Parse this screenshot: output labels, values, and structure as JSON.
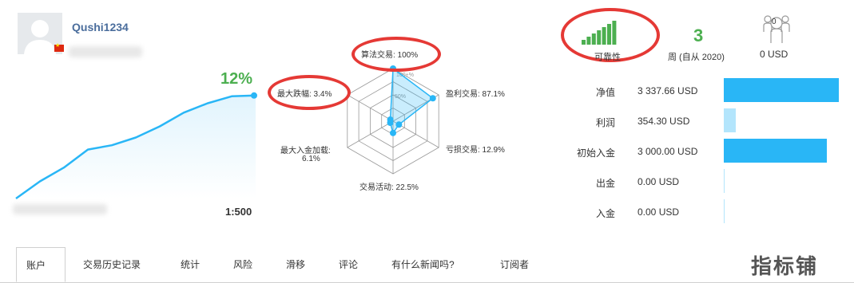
{
  "profile": {
    "username": "Qushi1234",
    "growth": "12%",
    "leverage": "1:500"
  },
  "growth_chart": {
    "type": "area",
    "values": [
      0,
      2.0,
      3.6,
      5.7,
      6.2,
      7.1,
      8.4,
      10.0,
      11.1,
      11.9,
      12.0
    ],
    "ylim": [
      0,
      13
    ],
    "color": "#29b6f6"
  },
  "radar": {
    "labels": {
      "algo": "算法交易: 100%",
      "profit": "盈利交易: 87.1%",
      "loss": "亏损交易: 12.9%",
      "activity": "交易活动: 22.5%",
      "load_line1": "最大入金加载:",
      "load_line2": "6.1%",
      "drawdown": "最大跌幅: 3.4%"
    },
    "ring_labels": [
      "100+%",
      "50%"
    ],
    "chart_data": {
      "type": "radar",
      "axes": [
        "算法交易",
        "盈利交易",
        "亏损交易",
        "交易活动",
        "最大入金加载",
        "最大跌幅"
      ],
      "values": [
        100,
        87.1,
        12.9,
        22.5,
        6.1,
        3.4
      ],
      "max": 100,
      "color": "#29b6f6"
    }
  },
  "reliability": {
    "label": "可靠性",
    "bars_total": 7,
    "bars_filled": 7,
    "color": "#4caf50"
  },
  "weeks": {
    "value": "3",
    "label": "周 (自从 2020)"
  },
  "subscribers": {
    "count": "0",
    "value": "0 USD"
  },
  "stats": [
    {
      "label": "净值",
      "value": "3 337.66 USD",
      "amount": 3337.66
    },
    {
      "label": "利润",
      "value": "354.30 USD",
      "amount": 354.3
    },
    {
      "label": "初始入金",
      "value": "3 000.00 USD",
      "amount": 3000.0
    },
    {
      "label": "出金",
      "value": "0.00 USD",
      "amount": 0
    },
    {
      "label": "入金",
      "value": "0.00 USD",
      "amount": 0
    }
  ],
  "tabs": [
    "账户",
    "交易历史记录",
    "统计",
    "风险",
    "滑移",
    "评论",
    "有什么新闻吗?",
    "订阅者"
  ],
  "active_tab": 0,
  "watermark": "指标铺",
  "colors": {
    "accent": "#29b6f6",
    "green": "#4caf50",
    "highlight_red": "#e53935",
    "link": "#4a6d9c"
  }
}
